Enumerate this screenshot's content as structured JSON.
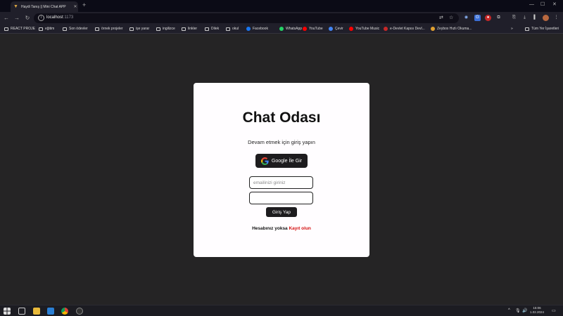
{
  "browser": {
    "tab_title": "Haydi Tanış || Mini Chat APP",
    "url_host": "localhost",
    "url_port": ":1173",
    "bookmarks": [
      {
        "label": "REACT PROJE",
        "icon": "folder-icon"
      },
      {
        "label": "eğitim",
        "icon": "folder-icon"
      },
      {
        "label": "Son ödevler",
        "icon": "folder-icon"
      },
      {
        "label": "örnek projeler",
        "icon": "folder-icon"
      },
      {
        "label": "işe yarar",
        "icon": "folder-icon"
      },
      {
        "label": "ingilizce",
        "icon": "folder-icon"
      },
      {
        "label": "linkler",
        "icon": "folder-icon"
      },
      {
        "label": "Dilek",
        "icon": "folder-icon"
      },
      {
        "label": "okul",
        "icon": "folder-icon"
      },
      {
        "label": "Facebook",
        "icon": "facebook-icon"
      },
      {
        "label": "WhatsApp",
        "icon": "whatsapp-icon"
      },
      {
        "label": "YouTube",
        "icon": "youtube-icon"
      },
      {
        "label": "Çevir",
        "icon": "translate-icon"
      },
      {
        "label": "YouTube Music",
        "icon": "youtube-music-icon"
      },
      {
        "label": "e-Devlet Kapısı Devl...",
        "icon": "edevlet-icon"
      },
      {
        "label": "Zeybox Hızlı Okuma...",
        "icon": "zeybox-icon"
      }
    ],
    "bookmarks_overflow": "»",
    "all_bookmarks": "Tüm Yer İşaretleri"
  },
  "page": {
    "title": "Chat Odası",
    "subtitle": "Devam etmek için giriş yapın",
    "google_button": "Google İle Gir",
    "email_placeholder": "emailinizi giriniz",
    "email_value": "",
    "password_value": "",
    "login_button": "Giriş Yap",
    "signup_prompt": "Hesabınız yoksa ",
    "signup_link": "Kayıt olun"
  },
  "taskbar": {
    "time": "15:06",
    "date": "1.02.2024"
  },
  "colors": {
    "page_background": "#252425",
    "card_background": "#fffdff",
    "button_background": "#1d1c1e",
    "link_red": "#d40f0f"
  }
}
